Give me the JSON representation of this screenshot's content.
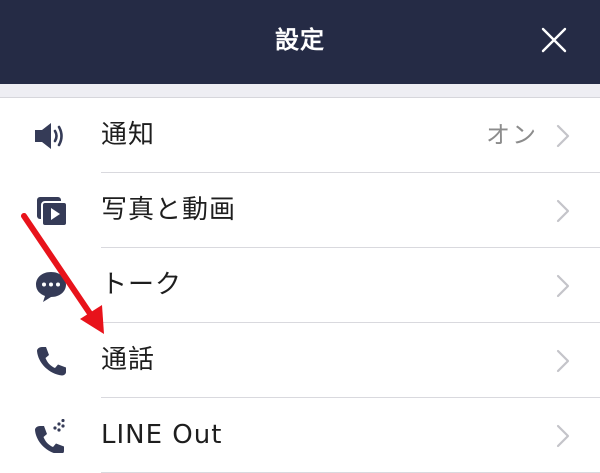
{
  "header": {
    "title": "設定"
  },
  "colors": {
    "header_bg": "#252b45",
    "icon": "#353b57",
    "annotation_arrow": "#e8131b"
  },
  "items": [
    {
      "label": "通知",
      "value": "オン",
      "icon": "speaker-icon"
    },
    {
      "label": "写真と動画",
      "value": "",
      "icon": "photo-video-icon"
    },
    {
      "label": "トーク",
      "value": "",
      "icon": "chat-bubble-icon"
    },
    {
      "label": "通話",
      "value": "",
      "icon": "phone-icon"
    },
    {
      "label": "LINE Out",
      "value": "",
      "icon": "line-out-phone-icon"
    }
  ]
}
